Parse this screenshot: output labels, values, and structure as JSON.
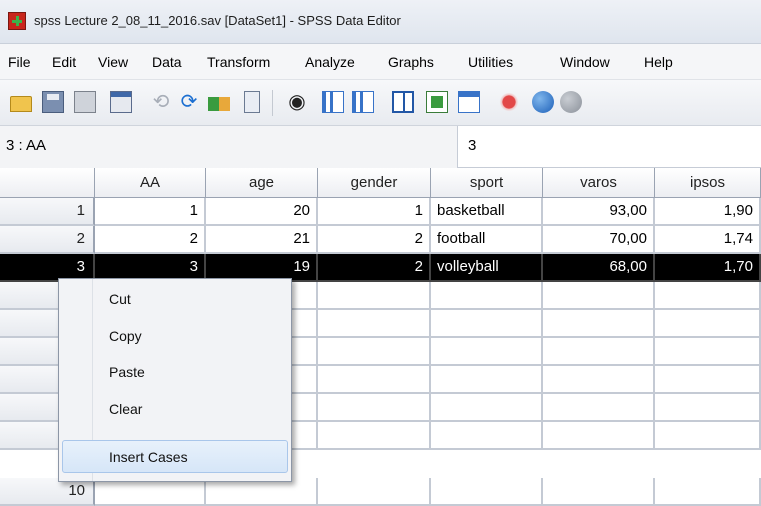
{
  "window": {
    "title": "spss Lecture 2_08_11_2016.sav [DataSet1] - SPSS Data Editor"
  },
  "menu": [
    "File",
    "Edit",
    "View",
    "Data",
    "Transform",
    "Analyze",
    "Graphs",
    "Utilities",
    "Window",
    "Help"
  ],
  "toolbar": {
    "icons": [
      "open-icon",
      "save-icon",
      "print-icon",
      "dialog-recall-icon",
      "undo-icon",
      "redo-icon",
      "goto-case-icon",
      "variables-icon",
      "find-icon",
      "insert-cases-icon",
      "insert-variable-icon",
      "split-file-icon",
      "weight-cases-icon",
      "select-cases-icon",
      "value-labels-icon",
      "use-sets-icon",
      "show-all-icon"
    ]
  },
  "editbar": {
    "cell_ref": "3 : AA",
    "cell_value": "3"
  },
  "grid": {
    "columns": [
      "AA",
      "age",
      "gender",
      "sport",
      "varos",
      "ipsos"
    ],
    "rows": [
      {
        "num": "1",
        "cells": [
          "1",
          "20",
          "1",
          "basketball",
          "93,00",
          "1,90"
        ]
      },
      {
        "num": "2",
        "cells": [
          "2",
          "21",
          "2",
          "football",
          "70,00",
          "1,74"
        ]
      },
      {
        "num": "3",
        "cells": [
          "3",
          "19",
          "2",
          "volleyball",
          "68,00",
          "1,70"
        ]
      }
    ],
    "last_row_num": "10",
    "selected_row": 3
  },
  "context_menu": {
    "items": [
      "Cut",
      "Copy",
      "Paste",
      "Clear",
      "Insert Cases"
    ],
    "highlighted": "Insert Cases"
  }
}
